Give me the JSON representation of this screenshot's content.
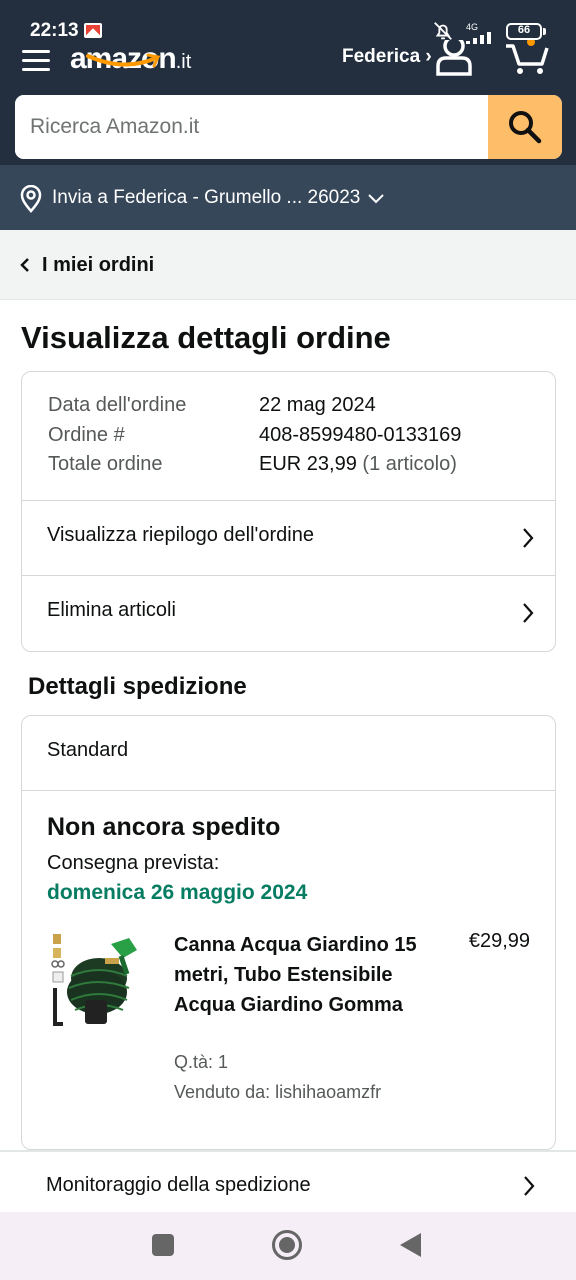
{
  "status_bar": {
    "time": "22:13",
    "network": "4G",
    "battery": "66"
  },
  "header": {
    "logo": "amazon",
    "logo_tld": ".it",
    "account_label": "Federica ›",
    "search_placeholder": "Ricerca Amazon.it",
    "deliver_to": "Invia a Federica - Grumello ... 26023"
  },
  "breadcrumb": {
    "label": "I miei ordini"
  },
  "page_title": "Visualizza dettagli ordine",
  "order_info": {
    "date_label": "Data dell'ordine",
    "date_value": "22 mag 2024",
    "number_label": "Ordine #",
    "number_value": "408-8599480-0133169",
    "total_label": "Totale ordine",
    "total_value": "EUR 23,99",
    "total_items": "(1 articolo)"
  },
  "order_links": [
    {
      "label": "Visualizza riepilogo dell'ordine"
    },
    {
      "label": "Elimina articoli"
    }
  ],
  "shipping": {
    "section_title": "Dettagli spedizione",
    "method": "Standard",
    "status": "Non ancora spedito",
    "delivery_label": "Consegna prevista:",
    "delivery_date": "domenica 26 maggio 2024",
    "product": {
      "title": "Canna Acqua Giardino 15 metri, Tubo Estensibile Acqua Giardino Gomma",
      "price": "€29,99",
      "qty": "Q.tà: 1",
      "seller": "Venduto da: lishihaoamzfr"
    }
  },
  "tracking": {
    "label": "Monitoraggio della spedizione"
  },
  "colors": {
    "header_bg": "#232f3e",
    "deliver_bar_bg": "#37475a",
    "search_button": "#febd69",
    "delivery_green": "#067d62"
  }
}
